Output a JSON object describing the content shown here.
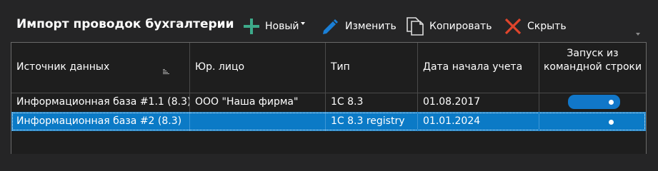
{
  "header": {
    "title": "Импорт проводок бухгалтерии"
  },
  "toolbar": {
    "new_label": "Новый",
    "edit_label": "Изменить",
    "copy_label": "Копировать",
    "hide_label": "Скрыть"
  },
  "colors": {
    "background": "#252526",
    "grid_background": "#1e1e1e",
    "selection": "#0b7ac6",
    "toggle_on": "#1177c9",
    "add_icon": "#3daa8a",
    "edit_icon": "#1a7fd6",
    "close_icon": "#e0452c"
  },
  "grid": {
    "columns": [
      {
        "label": "Источник данных",
        "sorted": true
      },
      {
        "label": "Юр. лицо"
      },
      {
        "label": "Тип"
      },
      {
        "label": "Дата начала учета"
      },
      {
        "label": "Запуск из командной строки"
      }
    ],
    "rows": [
      {
        "source": "Информационная база #1.1 (8.3)",
        "entity": "ООО \"Наша фирма\"",
        "type": "1С 8.3",
        "start_date": "01.08.2017",
        "cmd_launch": true,
        "selected": false
      },
      {
        "source": "Информационная база #2 (8.3)",
        "entity": "",
        "type": "1С 8.3 registry",
        "start_date": "01.01.2024",
        "cmd_launch": true,
        "selected": true
      }
    ]
  }
}
